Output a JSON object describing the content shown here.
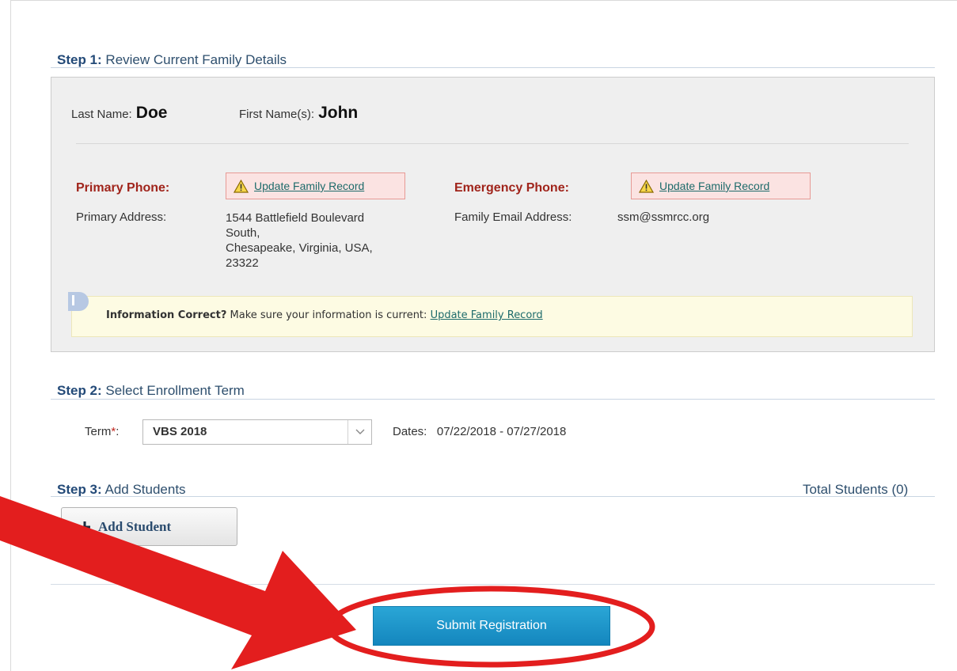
{
  "step1": {
    "number": "Step 1:",
    "title": "Review Current Family Details",
    "last_name_label": "Last Name:",
    "last_name": "Doe",
    "first_name_label": "First Name(s):",
    "first_name": "John",
    "primary_phone_label": "Primary Phone:",
    "emergency_phone_label": "Emergency Phone:",
    "update_link": "Update Family Record",
    "primary_address_label": "Primary Address:",
    "primary_address_lines": [
      "1544 Battlefield Boulevard",
      "South,",
      "Chesapeake, Virginia, USA,",
      "23322"
    ],
    "email_label": "Family Email Address:",
    "email": "ssm@ssmrcc.org",
    "info": {
      "bold": "Information Correct?",
      "text": "Make sure your information is current:",
      "link": "Update Family Record"
    }
  },
  "step2": {
    "number": "Step 2:",
    "title": "Select Enrollment Term",
    "term_label": "Term",
    "required_mark": "*",
    "term_colon": ":",
    "term_value": "VBS 2018",
    "dates_label": "Dates:",
    "dates_value": "07/22/2018 - 07/27/2018"
  },
  "step3": {
    "number": "Step 3:",
    "title": "Add Students",
    "total_students": "Total Students (0)",
    "add_student_label": "Add Student"
  },
  "submit_label": "Submit Registration",
  "colors": {
    "accent_red": "#e31e1e",
    "submit_blue": "#1a95c9",
    "heading_blue": "#234a78",
    "label_red": "#a0241b"
  }
}
